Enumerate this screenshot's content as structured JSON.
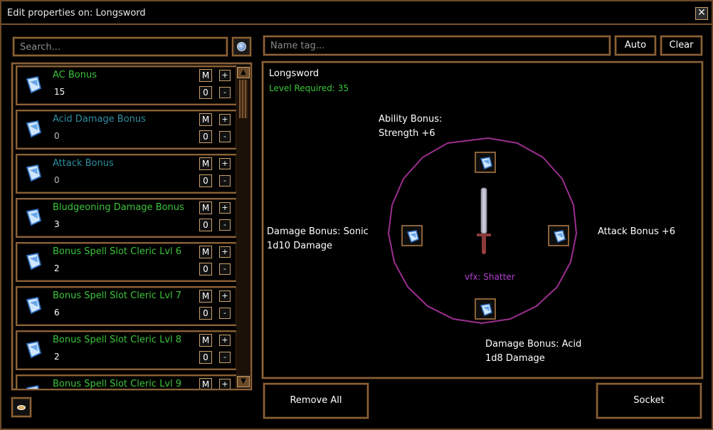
{
  "window": {
    "title": "Edit properties on: Longsword",
    "close_label": "✕"
  },
  "search": {
    "placeholder": "Search..."
  },
  "properties": [
    {
      "name": "AC Bonus",
      "value": "15",
      "color": "green"
    },
    {
      "name": "Acid Damage Bonus",
      "value": "0",
      "color": "teal"
    },
    {
      "name": "Attack Bonus",
      "value": "0",
      "color": "teal"
    },
    {
      "name": "Bludgeoning Damage Bonus",
      "value": "3",
      "color": "green"
    },
    {
      "name": "Bonus Spell Slot Cleric Lvl 6",
      "value": "2",
      "color": "green"
    },
    {
      "name": "Bonus Spell Slot Cleric Lvl 7",
      "value": "6",
      "color": "green"
    },
    {
      "name": "Bonus Spell Slot Cleric Lvl 8",
      "value": "2",
      "color": "green"
    },
    {
      "name": "Bonus Spell Slot Cleric Lvl 9",
      "value": "",
      "color": "green"
    }
  ],
  "row_buttons": {
    "m": "M",
    "plus": "+",
    "zero": "0",
    "minus": "-"
  },
  "name_tag": {
    "placeholder": "Name tag..."
  },
  "buttons": {
    "auto": "Auto",
    "clear": "Clear",
    "remove_all": "Remove All",
    "socket": "Socket"
  },
  "item": {
    "name": "Longsword",
    "level_required": "Level Required: 35",
    "vfx": "vfx: Shatter"
  },
  "sockets": {
    "top": {
      "line1": "Ability Bonus:",
      "line2": "Strength +6"
    },
    "left": {
      "line1": "Damage Bonus: Sonic",
      "line2": "1d10 Damage"
    },
    "right": {
      "line1": "Attack Bonus +6",
      "line2": ""
    },
    "bottom": {
      "line1": "Damage Bonus: Acid",
      "line2": "1d8 Damage"
    }
  },
  "colors": {
    "frame": "#8a6138",
    "ring": "#9b2f8f",
    "green_text": "#3ac43a",
    "teal_text": "#2d8fa0",
    "vfx_text": "#b23fd0"
  }
}
